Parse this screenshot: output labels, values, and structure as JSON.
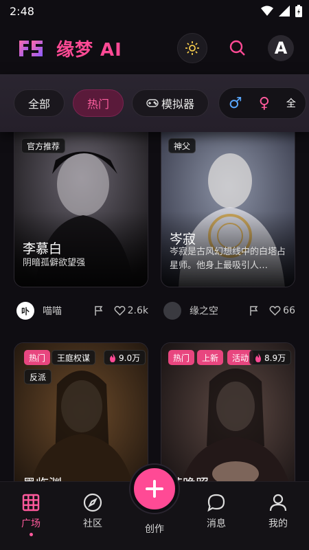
{
  "status_bar": {
    "time": "2:48"
  },
  "header": {
    "title": "缘梦 AI",
    "avatar_letter": "A"
  },
  "filters": {
    "chips": [
      {
        "label": "全部",
        "active": false
      },
      {
        "label": "热门",
        "active": true
      },
      {
        "label": "模拟器",
        "active": false
      }
    ],
    "gender": {
      "male": "♂",
      "female": "♀",
      "all": "全"
    }
  },
  "cards": [
    {
      "tags": [
        "官方推荐"
      ],
      "name": "李慕白",
      "desc": "阴暗孤僻欲望强"
    },
    {
      "tags": [
        "神父"
      ],
      "name": "岑寂",
      "desc": "岑寂是古风幻想线中的白塔占星师。他身上最吸引人…"
    },
    {
      "tags": [
        "热门",
        "王庭权谋",
        "反派"
      ],
      "heat": "9.0万",
      "name": "墨临渊"
    },
    {
      "tags": [
        "热门",
        "上新",
        "活动"
      ],
      "heat": "8.9万",
      "name": "苏晚照"
    }
  ],
  "authors": [
    {
      "name": "喵喵",
      "likes": "2.6k"
    },
    {
      "name": "缘之空",
      "likes": "66"
    }
  ],
  "nav": [
    {
      "label": "广场",
      "icon": "grid-icon",
      "active": true
    },
    {
      "label": "社区",
      "icon": "compass-icon",
      "active": false
    },
    {
      "label": "创作",
      "icon": "plus-icon",
      "active": false
    },
    {
      "label": "消息",
      "icon": "chat-icon",
      "active": false
    },
    {
      "label": "我的",
      "icon": "user-icon",
      "active": false
    }
  ],
  "colors": {
    "accent": "#ff4a95",
    "background": "#0f0d12",
    "tag_pink": "#e8467f"
  }
}
